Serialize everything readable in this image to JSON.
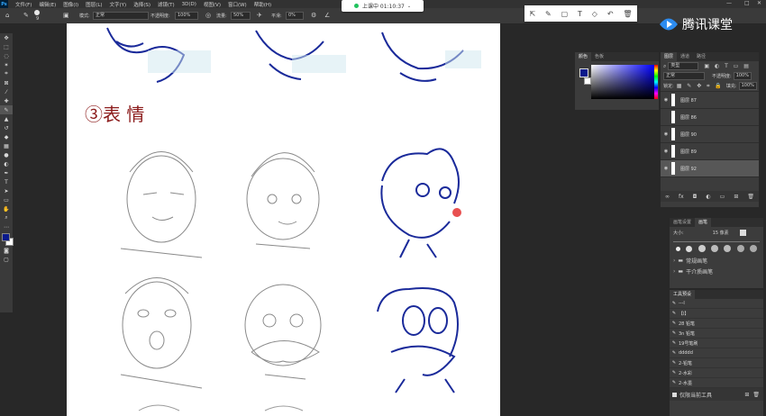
{
  "app": {
    "logo": "Ps"
  },
  "menu": [
    "文件(F)",
    "编辑(E)",
    "图像(I)",
    "图层(L)",
    "文字(Y)",
    "选择(S)",
    "滤镜(T)",
    "3D(D)",
    "视图(V)",
    "窗口(W)",
    "帮助(H)"
  ],
  "options": {
    "brush_size": "9",
    "mode_label": "模式:",
    "mode_value": "正常",
    "opacity_label": "不透明度:",
    "opacity_value": "100%",
    "flow_label": "流量:",
    "flow_value": "50%",
    "smooth_label": "平滑:",
    "smooth_value": "0%"
  },
  "live": {
    "status": "上课中 01:10:37"
  },
  "brand": {
    "name": "腾讯课堂"
  },
  "canvas": {
    "heading": "③表 情"
  },
  "color_panel": {
    "tabs": [
      "颜色",
      "色板"
    ],
    "foreground": "#0a1a8c",
    "background": "#ffffff"
  },
  "layers_panel": {
    "tabs": [
      "图层",
      "通道",
      "路径"
    ],
    "filter_label": "类型",
    "blend_mode": "正常",
    "opacity_label": "不透明度:",
    "opacity_value": "100%",
    "lock_label": "锁定:",
    "fill_label": "填充:",
    "fill_value": "100%",
    "layers": [
      "图层 87",
      "图层 86",
      "图层 90",
      "图层 89",
      "图层 92"
    ]
  },
  "brush_panel": {
    "tabs": [
      "画笔设置",
      "画笔"
    ],
    "size_label": "大小:",
    "size_value": "15 像素",
    "groups": [
      "常规画笔",
      "干介质画笔"
    ]
  },
  "tool_presets": {
    "title": "工具预设",
    "items": [
      "---l",
      "【l】",
      "28 铅笔",
      "3n 铅笔",
      "19号笔刷",
      "ddddd",
      "2-铅笔",
      "2-水彩",
      "2-水墨"
    ],
    "footer_label": "仅限当前工具"
  }
}
